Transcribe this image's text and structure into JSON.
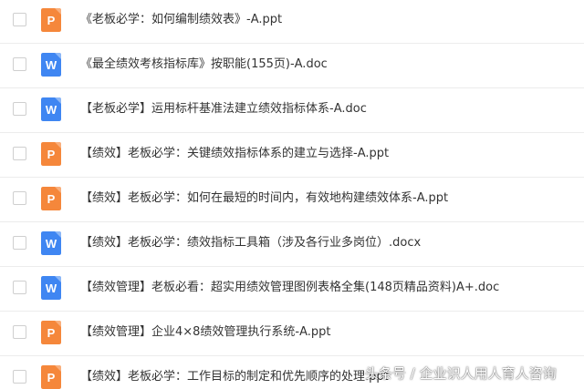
{
  "colors": {
    "ppt_icon": "#f5873b",
    "doc_icon": "#3f86f2",
    "text": "#333333",
    "divider": "#ececec"
  },
  "files": [
    {
      "icon": "ppt-icon",
      "letter": "P",
      "name": "《老板必学：如何编制绩效表》-A.ppt"
    },
    {
      "icon": "doc-icon",
      "letter": "W",
      "name": "《最全绩效考核指标库》按职能(155页)-A.doc"
    },
    {
      "icon": "doc-icon",
      "letter": "W",
      "name": "【老板必学】运用标杆基准法建立绩效指标体系-A.doc"
    },
    {
      "icon": "ppt-icon",
      "letter": "P",
      "name": "【绩效】老板必学：关键绩效指标体系的建立与选择-A.ppt"
    },
    {
      "icon": "ppt-icon",
      "letter": "P",
      "name": "【绩效】老板必学：如何在最短的时间内，有效地构建绩效体系-A.ppt"
    },
    {
      "icon": "doc-icon",
      "letter": "W",
      "name": "【绩效】老板必学：绩效指标工具箱（涉及各行业多岗位）.docx"
    },
    {
      "icon": "doc-icon",
      "letter": "W",
      "name": "【绩效管理】老板必看：超实用绩效管理图例表格全集(148页精品资料)A+.doc"
    },
    {
      "icon": "ppt-icon",
      "letter": "P",
      "name": "【绩效管理】企业4×8绩效管理执行系统-A.ppt"
    },
    {
      "icon": "ppt-icon",
      "letter": "P",
      "name": "【绩效】老板必学：工作目标的制定和优先顺序的处理.ppt"
    }
  ],
  "watermark": "头条号 / 企业识人用人育人咨询"
}
